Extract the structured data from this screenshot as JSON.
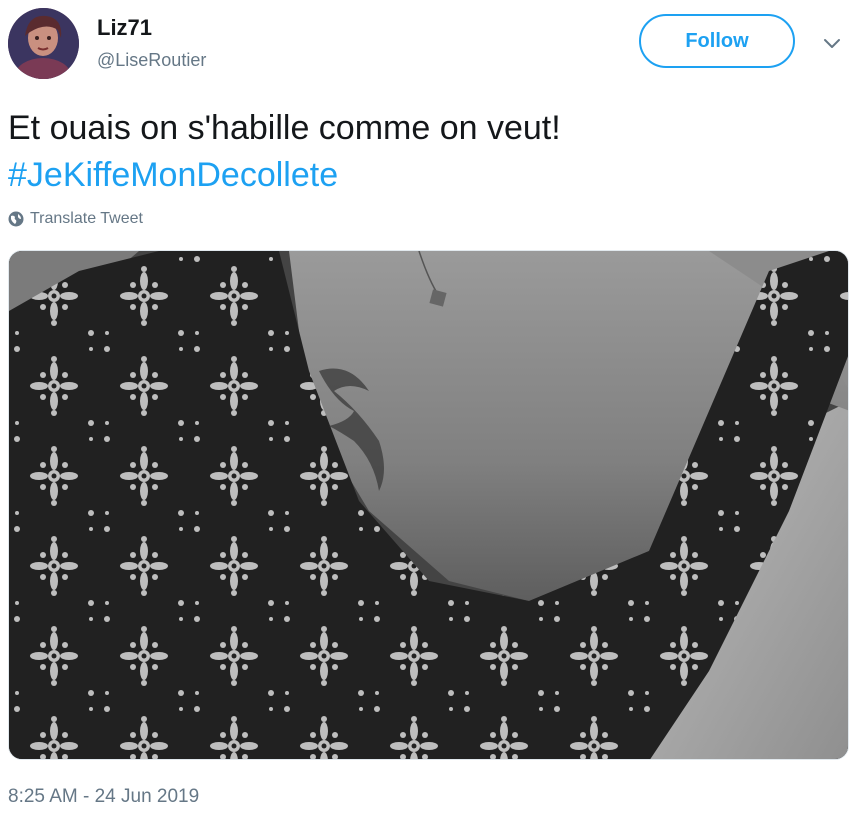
{
  "user": {
    "display_name": "Liz71",
    "handle": "@LiseRoutier"
  },
  "follow_button": {
    "label": "Follow"
  },
  "tweet": {
    "text_line1": "Et ouais on s'habille comme on veut!",
    "hashtag": "#JeKiffeMonDecollete",
    "translate_label": "Translate Tweet",
    "timestamp": "8:25 AM - 24 Jun 2019"
  },
  "icons": {
    "caret": "chevron-down-icon",
    "translate": "globe-icon"
  },
  "colors": {
    "accent": "#1da1f2",
    "secondary_text": "#657786",
    "primary_text": "#14171a",
    "border": "#e1e8ed"
  }
}
